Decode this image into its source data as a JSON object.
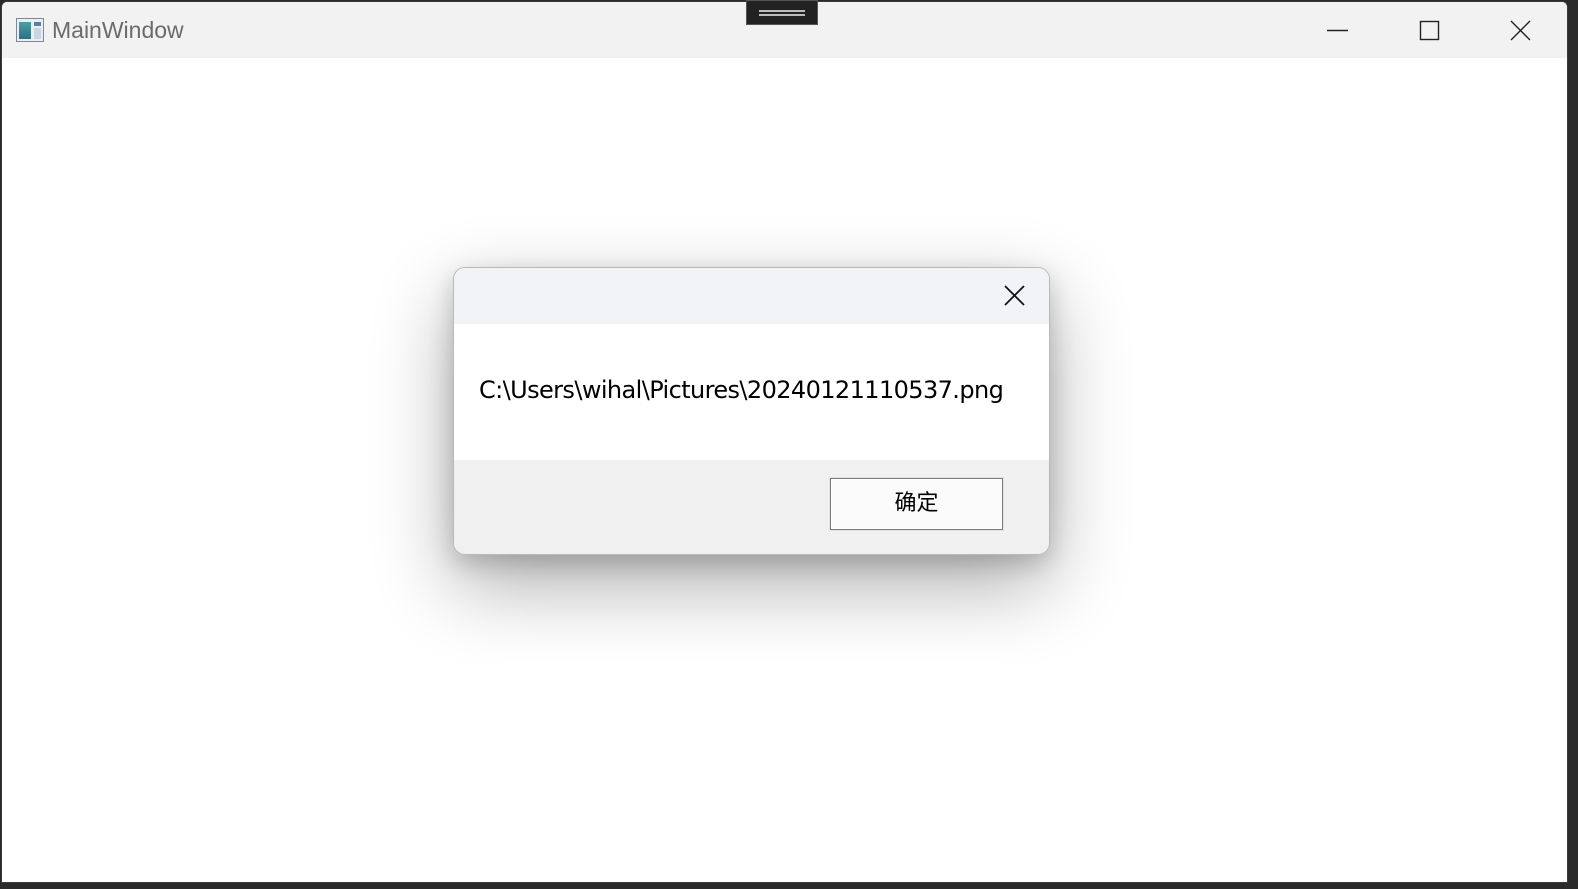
{
  "window": {
    "title": "MainWindow",
    "icon": "app-window-icon"
  },
  "caption_buttons": {
    "minimize_icon": "minimize-icon",
    "maximize_icon": "maximize-icon",
    "close_icon": "close-icon"
  },
  "dialog": {
    "title": "",
    "message": "C:\\Users\\wihal\\Pictures\\20240121110537.png",
    "ok_label": "确定",
    "close_icon": "close-icon"
  }
}
